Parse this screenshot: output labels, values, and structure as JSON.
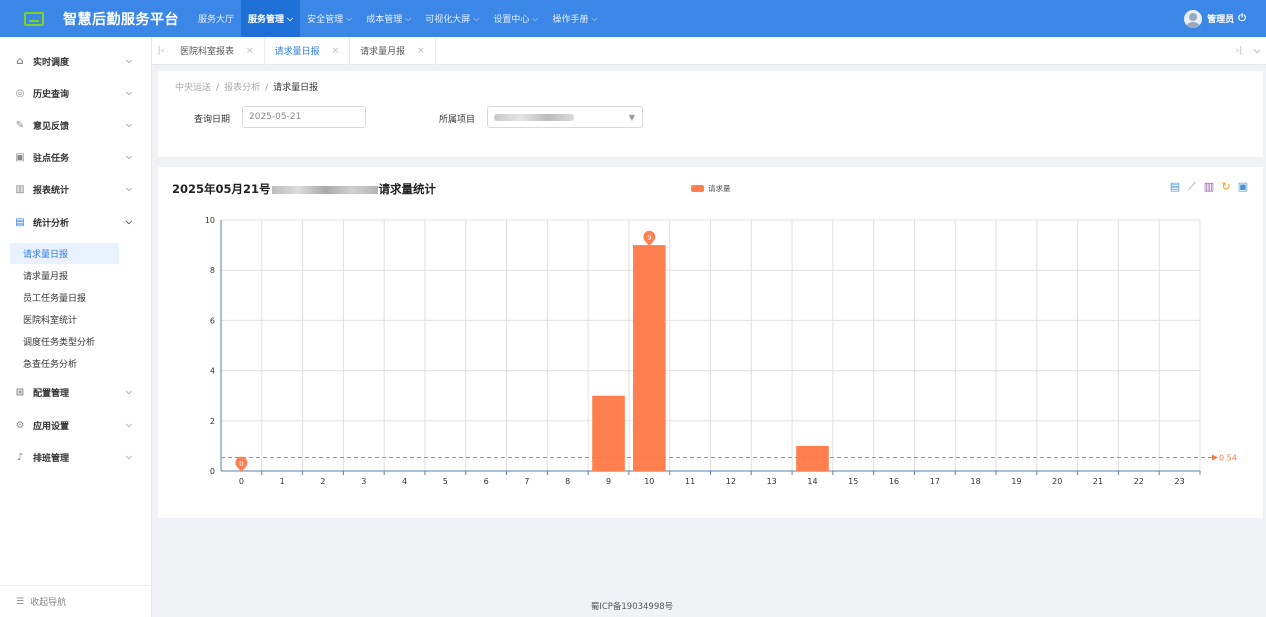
{
  "header": {
    "app_title": "智慧后勤服务平台",
    "nav": [
      {
        "label": "服务大厅",
        "active": false,
        "caret": false
      },
      {
        "label": "服务管理",
        "active": true,
        "caret": true
      },
      {
        "label": "安全管理",
        "active": false,
        "caret": true
      },
      {
        "label": "成本管理",
        "active": false,
        "caret": true
      },
      {
        "label": "可视化大屏",
        "active": false,
        "caret": true
      },
      {
        "label": "设置中心",
        "active": false,
        "caret": true
      },
      {
        "label": "操作手册",
        "active": false,
        "caret": true
      }
    ],
    "user_name": "管理员"
  },
  "sidebar": {
    "menu": [
      {
        "label": "实时调度",
        "icon": "home-icon",
        "glyph": "⌂"
      },
      {
        "label": "历史查询",
        "icon": "history-icon",
        "glyph": "◎"
      },
      {
        "label": "意见反馈",
        "icon": "edit-icon",
        "glyph": "✎"
      },
      {
        "label": "驻点任务",
        "icon": "briefcase-icon",
        "glyph": "▣"
      },
      {
        "label": "报表统计",
        "icon": "bar-chart-icon",
        "glyph": "▥"
      },
      {
        "label": "统计分析",
        "icon": "analytics-icon",
        "glyph": "▤"
      }
    ],
    "submenu": [
      "请求量日报",
      "请求量月报",
      "员工任务量日报",
      "医院科室统计",
      "调度任务类型分析",
      "急查任务分析"
    ],
    "submenu_active_index": 0,
    "menu_after": [
      {
        "label": "配置管理",
        "icon": "grid-icon",
        "glyph": "⊞"
      },
      {
        "label": "应用设置",
        "icon": "settings-icon",
        "glyph": "⚙"
      },
      {
        "label": "排班管理",
        "icon": "bell-icon",
        "glyph": "♪"
      }
    ],
    "collapse_label": "收起导航"
  },
  "tabs": [
    {
      "label": "医院科室报表",
      "active": false
    },
    {
      "label": "请求量日报",
      "active": true
    },
    {
      "label": "请求量月报",
      "active": false
    }
  ],
  "filter": {
    "breadcrumb": [
      "中央运送",
      "报表分析",
      "请求量日报"
    ],
    "date_label": "查询日期",
    "date_value": "2025-05-21",
    "project_label": "所属项目"
  },
  "chart_panel": {
    "title_prefix": "2025年05月21号",
    "title_suffix": "请求量统计",
    "legend_label": "请求量",
    "tools": [
      {
        "icon": "data-view-icon",
        "glyph": "▤",
        "color": "#4a90d9"
      },
      {
        "icon": "line-chart-icon",
        "glyph": "⟋",
        "color": "#59b14a"
      },
      {
        "icon": "bar-chart-icon",
        "glyph": "▥",
        "color": "#9b59b6"
      },
      {
        "icon": "refresh-icon",
        "glyph": "↻",
        "color": "#f39c12"
      },
      {
        "icon": "save-image-icon",
        "glyph": "▣",
        "color": "#4a90d9"
      }
    ]
  },
  "chart_data": {
    "type": "bar",
    "categories": [
      "0",
      "1",
      "2",
      "3",
      "4",
      "5",
      "6",
      "7",
      "8",
      "9",
      "10",
      "11",
      "12",
      "13",
      "14",
      "15",
      "16",
      "17",
      "18",
      "19",
      "20",
      "21",
      "22",
      "23"
    ],
    "series": [
      {
        "name": "请求量",
        "values": [
          0,
          0,
          0,
          0,
          0,
          0,
          0,
          0,
          0,
          3,
          9,
          0,
          0,
          0,
          1,
          0,
          0,
          0,
          0,
          0,
          0,
          0,
          0,
          0
        ]
      }
    ],
    "ylim": [
      0,
      10
    ],
    "yticks": [
      0,
      2,
      4,
      6,
      8,
      10
    ],
    "markpoints": [
      {
        "category": "0",
        "value": 0,
        "label": "0"
      },
      {
        "category": "10",
        "value": 9,
        "label": "9"
      }
    ],
    "markline": {
      "value": 0.54,
      "label": "0.54"
    },
    "grid": true,
    "legend_position": "top-center",
    "color": "#ff7f50"
  },
  "footer": {
    "icp": "蜀ICP备19034998号"
  }
}
